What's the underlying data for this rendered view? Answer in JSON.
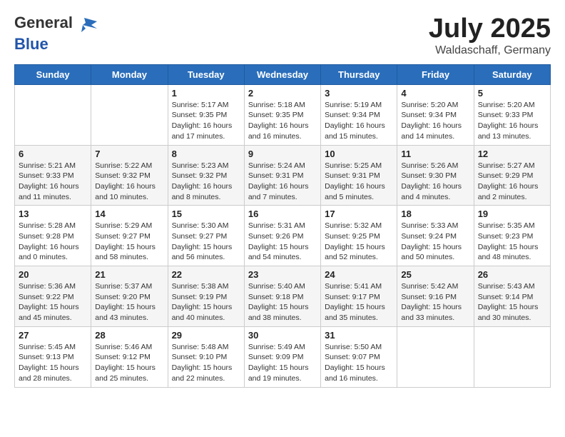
{
  "logo": {
    "text_general": "General",
    "text_blue": "Blue"
  },
  "title": "July 2025",
  "location": "Waldaschaff, Germany",
  "days_of_week": [
    "Sunday",
    "Monday",
    "Tuesday",
    "Wednesday",
    "Thursday",
    "Friday",
    "Saturday"
  ],
  "weeks": [
    [
      {
        "day": "",
        "info": ""
      },
      {
        "day": "",
        "info": ""
      },
      {
        "day": "1",
        "info": "Sunrise: 5:17 AM\nSunset: 9:35 PM\nDaylight: 16 hours\nand 17 minutes."
      },
      {
        "day": "2",
        "info": "Sunrise: 5:18 AM\nSunset: 9:35 PM\nDaylight: 16 hours\nand 16 minutes."
      },
      {
        "day": "3",
        "info": "Sunrise: 5:19 AM\nSunset: 9:34 PM\nDaylight: 16 hours\nand 15 minutes."
      },
      {
        "day": "4",
        "info": "Sunrise: 5:20 AM\nSunset: 9:34 PM\nDaylight: 16 hours\nand 14 minutes."
      },
      {
        "day": "5",
        "info": "Sunrise: 5:20 AM\nSunset: 9:33 PM\nDaylight: 16 hours\nand 13 minutes."
      }
    ],
    [
      {
        "day": "6",
        "info": "Sunrise: 5:21 AM\nSunset: 9:33 PM\nDaylight: 16 hours\nand 11 minutes."
      },
      {
        "day": "7",
        "info": "Sunrise: 5:22 AM\nSunset: 9:32 PM\nDaylight: 16 hours\nand 10 minutes."
      },
      {
        "day": "8",
        "info": "Sunrise: 5:23 AM\nSunset: 9:32 PM\nDaylight: 16 hours\nand 8 minutes."
      },
      {
        "day": "9",
        "info": "Sunrise: 5:24 AM\nSunset: 9:31 PM\nDaylight: 16 hours\nand 7 minutes."
      },
      {
        "day": "10",
        "info": "Sunrise: 5:25 AM\nSunset: 9:31 PM\nDaylight: 16 hours\nand 5 minutes."
      },
      {
        "day": "11",
        "info": "Sunrise: 5:26 AM\nSunset: 9:30 PM\nDaylight: 16 hours\nand 4 minutes."
      },
      {
        "day": "12",
        "info": "Sunrise: 5:27 AM\nSunset: 9:29 PM\nDaylight: 16 hours\nand 2 minutes."
      }
    ],
    [
      {
        "day": "13",
        "info": "Sunrise: 5:28 AM\nSunset: 9:28 PM\nDaylight: 16 hours\nand 0 minutes."
      },
      {
        "day": "14",
        "info": "Sunrise: 5:29 AM\nSunset: 9:27 PM\nDaylight: 15 hours\nand 58 minutes."
      },
      {
        "day": "15",
        "info": "Sunrise: 5:30 AM\nSunset: 9:27 PM\nDaylight: 15 hours\nand 56 minutes."
      },
      {
        "day": "16",
        "info": "Sunrise: 5:31 AM\nSunset: 9:26 PM\nDaylight: 15 hours\nand 54 minutes."
      },
      {
        "day": "17",
        "info": "Sunrise: 5:32 AM\nSunset: 9:25 PM\nDaylight: 15 hours\nand 52 minutes."
      },
      {
        "day": "18",
        "info": "Sunrise: 5:33 AM\nSunset: 9:24 PM\nDaylight: 15 hours\nand 50 minutes."
      },
      {
        "day": "19",
        "info": "Sunrise: 5:35 AM\nSunset: 9:23 PM\nDaylight: 15 hours\nand 48 minutes."
      }
    ],
    [
      {
        "day": "20",
        "info": "Sunrise: 5:36 AM\nSunset: 9:22 PM\nDaylight: 15 hours\nand 45 minutes."
      },
      {
        "day": "21",
        "info": "Sunrise: 5:37 AM\nSunset: 9:20 PM\nDaylight: 15 hours\nand 43 minutes."
      },
      {
        "day": "22",
        "info": "Sunrise: 5:38 AM\nSunset: 9:19 PM\nDaylight: 15 hours\nand 40 minutes."
      },
      {
        "day": "23",
        "info": "Sunrise: 5:40 AM\nSunset: 9:18 PM\nDaylight: 15 hours\nand 38 minutes."
      },
      {
        "day": "24",
        "info": "Sunrise: 5:41 AM\nSunset: 9:17 PM\nDaylight: 15 hours\nand 35 minutes."
      },
      {
        "day": "25",
        "info": "Sunrise: 5:42 AM\nSunset: 9:16 PM\nDaylight: 15 hours\nand 33 minutes."
      },
      {
        "day": "26",
        "info": "Sunrise: 5:43 AM\nSunset: 9:14 PM\nDaylight: 15 hours\nand 30 minutes."
      }
    ],
    [
      {
        "day": "27",
        "info": "Sunrise: 5:45 AM\nSunset: 9:13 PM\nDaylight: 15 hours\nand 28 minutes."
      },
      {
        "day": "28",
        "info": "Sunrise: 5:46 AM\nSunset: 9:12 PM\nDaylight: 15 hours\nand 25 minutes."
      },
      {
        "day": "29",
        "info": "Sunrise: 5:48 AM\nSunset: 9:10 PM\nDaylight: 15 hours\nand 22 minutes."
      },
      {
        "day": "30",
        "info": "Sunrise: 5:49 AM\nSunset: 9:09 PM\nDaylight: 15 hours\nand 19 minutes."
      },
      {
        "day": "31",
        "info": "Sunrise: 5:50 AM\nSunset: 9:07 PM\nDaylight: 15 hours\nand 16 minutes."
      },
      {
        "day": "",
        "info": ""
      },
      {
        "day": "",
        "info": ""
      }
    ]
  ]
}
